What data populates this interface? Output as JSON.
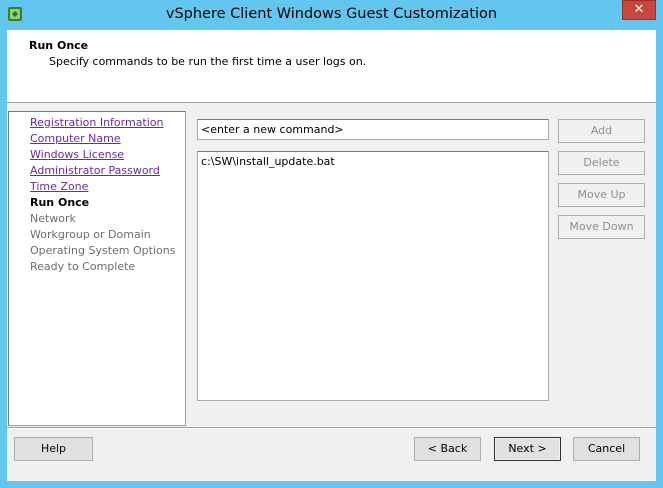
{
  "window": {
    "title": "vSphere Client Windows Guest Customization",
    "close_label": "✕",
    "colors": {
      "frame": "#63c6ee",
      "close": "#c7463d",
      "link": "#6a2aa8"
    }
  },
  "header": {
    "title": "Run Once",
    "subtitle": "Specify commands to be run the first time a user logs on."
  },
  "nav": {
    "items": [
      {
        "label": "Registration Information",
        "state": "link"
      },
      {
        "label": "Computer Name",
        "state": "link"
      },
      {
        "label": "Windows License",
        "state": "link"
      },
      {
        "label": "Administrator Password",
        "state": "link"
      },
      {
        "label": "Time Zone",
        "state": "link"
      },
      {
        "label": "Run Once",
        "state": "current"
      },
      {
        "label": "Network",
        "state": "disabled"
      },
      {
        "label": "Workgroup or Domain",
        "state": "disabled"
      },
      {
        "label": "Operating System Options",
        "state": "disabled"
      },
      {
        "label": "Ready to Complete",
        "state": "disabled"
      }
    ]
  },
  "command": {
    "input_value": "<enter a new command>",
    "list": [
      "c:\\SW\\install_update.bat"
    ]
  },
  "side_buttons": {
    "add": "Add",
    "delete": "Delete",
    "move_up": "Move Up",
    "move_down": "Move Down"
  },
  "footer": {
    "help": "Help",
    "back": "< Back",
    "next": "Next >",
    "cancel": "Cancel"
  }
}
